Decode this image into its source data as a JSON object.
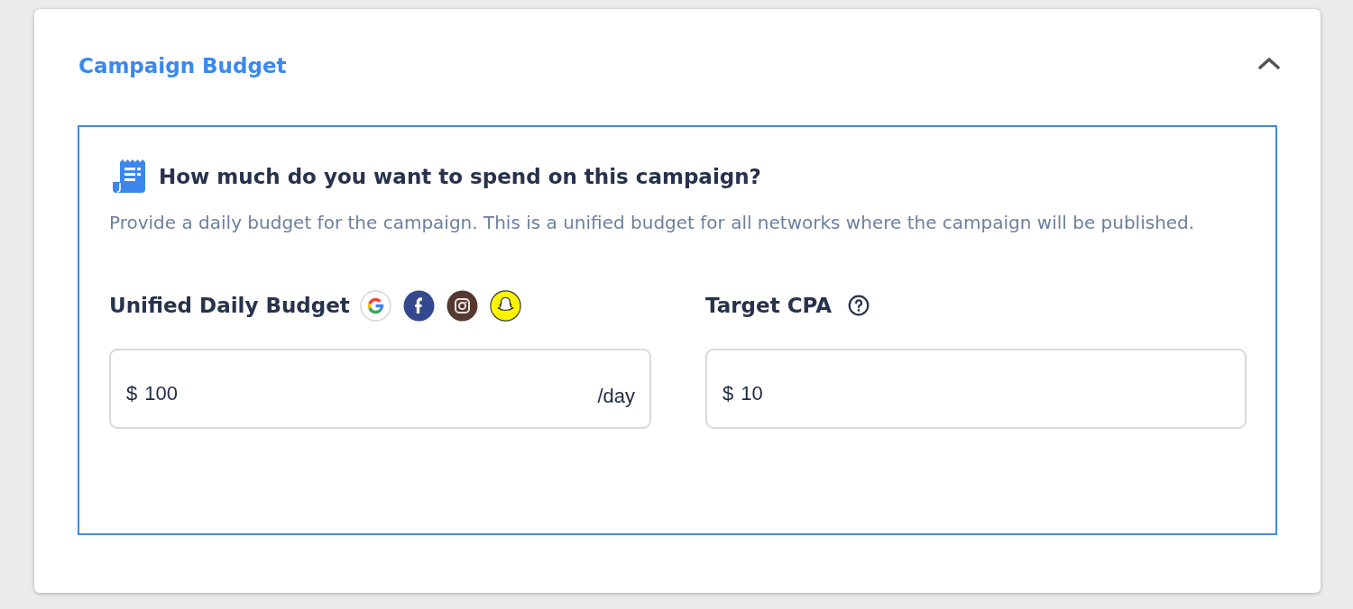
{
  "card": {
    "title": "Campaign Budget",
    "expanded": true
  },
  "section": {
    "heading": "How much do you want to spend on this campaign?",
    "description": "Provide a daily budget for the campaign. This is a unified budget for all networks where the campaign will be published."
  },
  "fields": [
    {
      "kind": "budget",
      "label": "Unified Daily Budget",
      "prefix": "$",
      "value": "100",
      "suffix": "/day"
    },
    {
      "kind": "target",
      "label": "Target CPA",
      "prefix": "$",
      "value": "10"
    }
  ]
}
